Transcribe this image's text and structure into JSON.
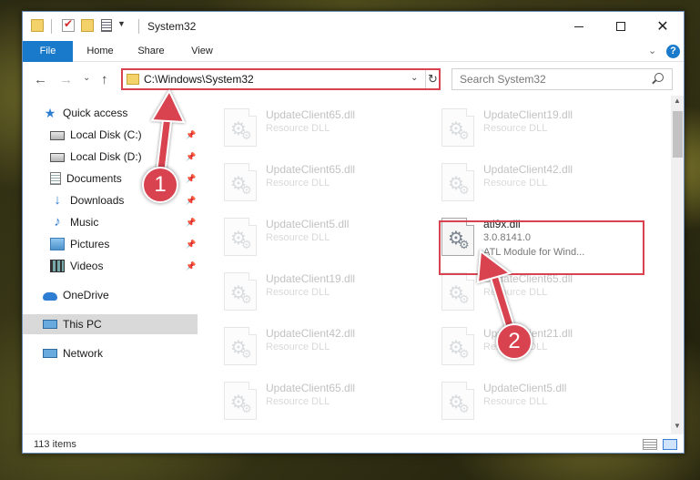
{
  "window": {
    "title": "System32",
    "minimize_label": "",
    "maximize_label": "",
    "close_label": "✕"
  },
  "ribbon": {
    "tabs": [
      {
        "label": "File"
      },
      {
        "label": "Home"
      },
      {
        "label": "Share"
      },
      {
        "label": "View"
      }
    ],
    "help_label": "?"
  },
  "nav": {
    "address": "C:\\Windows\\System32",
    "search_placeholder": "Search System32"
  },
  "sidebar": {
    "items": [
      {
        "label": "Quick access",
        "icon": "star-icon"
      },
      {
        "label": "Local Disk (C:)",
        "icon": "drive-icon",
        "pinned": true
      },
      {
        "label": "Local Disk (D:)",
        "icon": "drive-icon",
        "pinned": true
      },
      {
        "label": "Documents",
        "icon": "document-icon",
        "pinned": true
      },
      {
        "label": "Downloads",
        "icon": "download-icon",
        "pinned": true
      },
      {
        "label": "Music",
        "icon": "music-icon",
        "pinned": true
      },
      {
        "label": "Pictures",
        "icon": "pictures-icon",
        "pinned": true
      },
      {
        "label": "Videos",
        "icon": "video-icon",
        "pinned": true
      },
      {
        "label": "OneDrive",
        "icon": "cloud-icon"
      },
      {
        "label": "This PC",
        "icon": "computer-icon",
        "selected": true
      },
      {
        "label": "Network",
        "icon": "network-icon"
      }
    ]
  },
  "files": [
    {
      "name": "UpdateClient65.dll",
      "desc": "Resource DLL"
    },
    {
      "name": "UpdateClient19.dll",
      "desc": "Resource DLL"
    },
    {
      "name": "UpdateClient65.dll",
      "desc": "Resource DLL"
    },
    {
      "name": "UpdateClient42.dll",
      "desc": "Resource DLL"
    },
    {
      "name": "UpdateClient5.dll",
      "desc": "Resource DLL"
    },
    {
      "name": "atl9x.dll",
      "desc": "3.0.8141.0",
      "desc2": "ATL Module for Wind...",
      "highlighted": true
    },
    {
      "name": "UpdateClient19.dll",
      "desc": "Resource DLL"
    },
    {
      "name": "UpdateClient65.dll",
      "desc": "Resource DLL"
    },
    {
      "name": "UpdateClient42.dll",
      "desc": "Resource DLL"
    },
    {
      "name": "UpdateClient21.dll",
      "desc": "Resource DLL"
    },
    {
      "name": "UpdateClient65.dll",
      "desc": "Resource DLL"
    },
    {
      "name": "UpdateClient5.dll",
      "desc": "Resource DLL"
    }
  ],
  "status": {
    "item_count": "113 items"
  },
  "annotations": {
    "badge1": "1",
    "badge2": "2",
    "color": "#d9434f"
  }
}
